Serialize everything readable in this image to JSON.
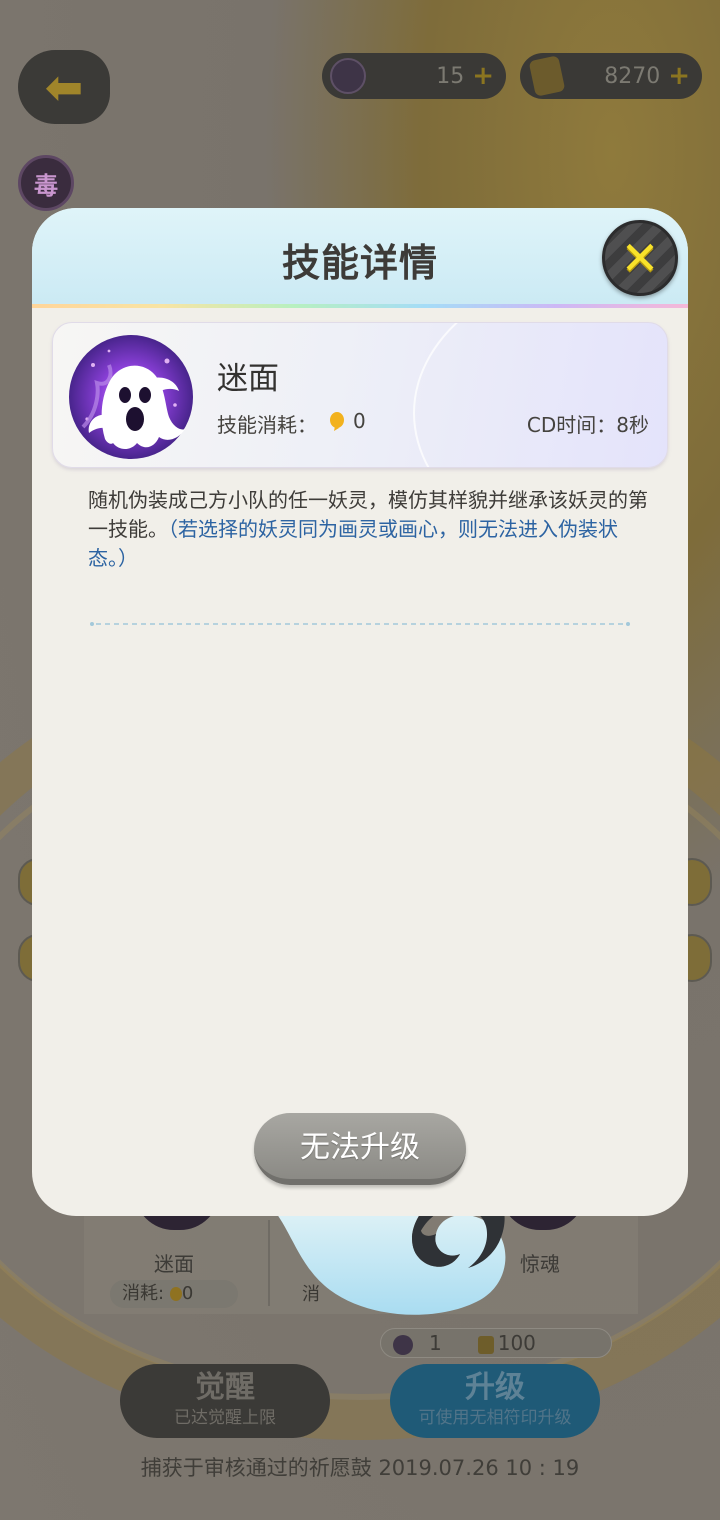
{
  "currencies": {
    "spirit": {
      "icon": "spirit-orb-icon",
      "value": "15",
      "plus": "+"
    },
    "coins": {
      "icon": "gold-coin-icon",
      "value": "8270",
      "plus": "+"
    }
  },
  "background": {
    "back_icon": "back-arrow-icon",
    "poison_badge": "毒",
    "skills_strip": {
      "skill_1_name": "迷面",
      "skill_1_cost_label": "消耗:",
      "skill_1_cost_value": "0",
      "skill_2_cost_fragment": "消",
      "skill_3_name": "惊魂"
    },
    "upgrade_cost": {
      "spirit": "1",
      "coins": "100"
    },
    "awaken_button": {
      "label": "觉醒",
      "sublabel": "已达觉醒上限"
    },
    "upgrade_button": {
      "label": "升级",
      "sublabel": "可使用无相符印升级"
    },
    "capture_info": "捕获于审核通过的祈愿鼓  2019.07.26   10 : 19"
  },
  "dialog": {
    "title": "技能详情",
    "close_icon": "close-x-icon",
    "skill": {
      "icon": "ghost-skill-icon",
      "name": "迷面",
      "cost_label": "技能消耗：",
      "cost_value": "0",
      "cd": "CD时间：8秒"
    },
    "description": "随机伪装成己方小队的任一妖灵，模仿其样貌并继承该妖灵的第一技能。",
    "description_note": "（若选择的妖灵同为画灵或画心，则无法进入伪装状态。）",
    "button_label": "无法升级"
  },
  "colors": {
    "header_bg": "#dff4f9",
    "dialog_bg": "#f1efe9",
    "note_blue": "#2c63a2",
    "close_yellow": "#f8e22a",
    "disabled_button": "#a8a7a2"
  }
}
